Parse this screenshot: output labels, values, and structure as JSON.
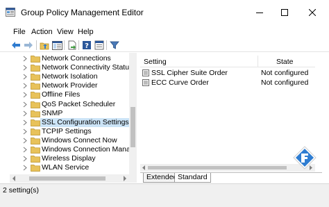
{
  "window": {
    "title": "Group Policy Management Editor",
    "controls": [
      "minimize",
      "maximize",
      "close"
    ]
  },
  "menu": {
    "items": [
      "File",
      "Action",
      "View",
      "Help"
    ]
  },
  "toolbar": {
    "buttons": [
      "back-icon",
      "forward-icon",
      "up-folder-icon",
      "show-hide-tree-icon",
      "export-list-icon",
      "help-icon",
      "properties-icon",
      "filter-icon"
    ]
  },
  "tree": {
    "items": [
      {
        "label": "Network Connections",
        "selected": false
      },
      {
        "label": "Network Connectivity Status Ind",
        "selected": false
      },
      {
        "label": "Network Isolation",
        "selected": false
      },
      {
        "label": "Network Provider",
        "selected": false
      },
      {
        "label": "Offline Files",
        "selected": false
      },
      {
        "label": "QoS Packet Scheduler",
        "selected": false
      },
      {
        "label": "SNMP",
        "selected": false
      },
      {
        "label": "SSL Configuration Settings",
        "selected": true
      },
      {
        "label": "TCPIP Settings",
        "selected": false
      },
      {
        "label": "Windows Connect Now",
        "selected": false
      },
      {
        "label": "Windows Connection Manager",
        "selected": false
      },
      {
        "label": "Wireless Display",
        "selected": false
      },
      {
        "label": "WLAN Service",
        "selected": false
      }
    ]
  },
  "list": {
    "columns": {
      "setting": "Setting",
      "state": "State"
    },
    "rows": [
      {
        "name": "SSL Cipher Suite Order",
        "state": "Not configured"
      },
      {
        "name": "ECC Curve Order",
        "state": "Not configured"
      }
    ]
  },
  "tabs": {
    "extended": "Extended",
    "standard": "Standard",
    "active": "Standard"
  },
  "status": {
    "text": "2 setting(s)"
  },
  "colors": {
    "selection": "#cce4f7",
    "folder": "#e8c25a",
    "accent": "#2b579a"
  }
}
